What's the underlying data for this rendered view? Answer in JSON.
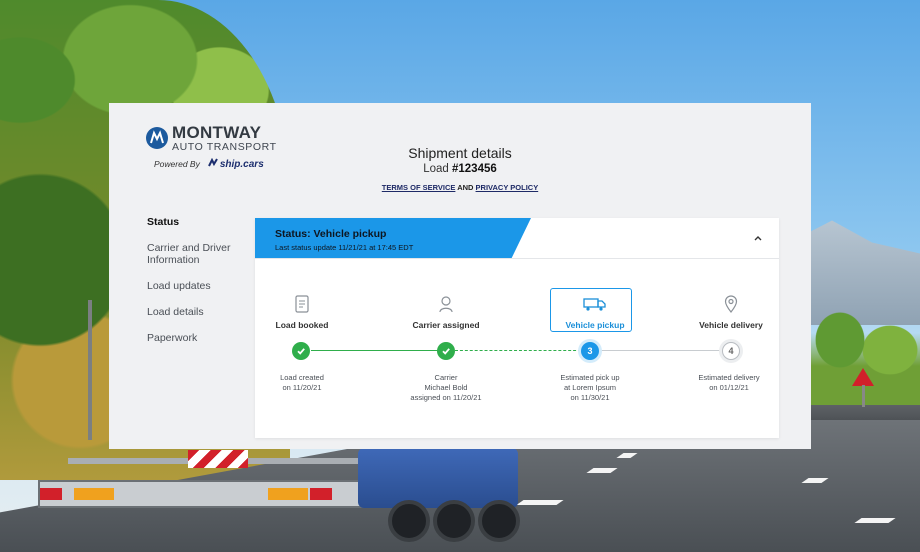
{
  "brand": {
    "name_line1": "MONTWAY",
    "name_line2": "AUTO TRANSPORT",
    "powered_by": "Powered By",
    "partner": "ship.cars"
  },
  "header": {
    "title": "Shipment details",
    "load_prefix": "Load ",
    "load_number": "#123456",
    "terms_label": "TERMS OF SERVICE",
    "and": " AND ",
    "privacy_label": "PRIVACY POLICY"
  },
  "sidebar": {
    "items": [
      {
        "label": "Status",
        "active": true
      },
      {
        "label": "Carrier and Driver Information",
        "active": false
      },
      {
        "label": "Load updates",
        "active": false
      },
      {
        "label": "Load details",
        "active": false
      },
      {
        "label": "Paperwork",
        "active": false
      }
    ]
  },
  "status": {
    "title": "Status: Vehicle pickup",
    "last_update": "Last status update 11/21/21 at 17:45 EDT",
    "accent_color": "#1b97e8",
    "done_color": "#2fae4b"
  },
  "steps": [
    {
      "label": "Load booked",
      "icon": "document-icon",
      "node": "check",
      "desc": [
        "Load created",
        "on 11/20/21"
      ]
    },
    {
      "label": "Carrier assigned",
      "icon": "person-icon",
      "node": "check",
      "desc": [
        "Carrier",
        "Michael Bold",
        "assigned on 11/20/21"
      ]
    },
    {
      "label": "Vehicle pickup",
      "icon": "truck-icon",
      "node": "3",
      "desc": [
        "Estimated pick up",
        "at Lorem Ipsum",
        "on 11/30/21"
      ]
    },
    {
      "label": "Vehicle delivery",
      "icon": "location-pin-icon",
      "node": "4",
      "desc": [
        "Estimated delivery",
        "on 01/12/21"
      ]
    }
  ]
}
